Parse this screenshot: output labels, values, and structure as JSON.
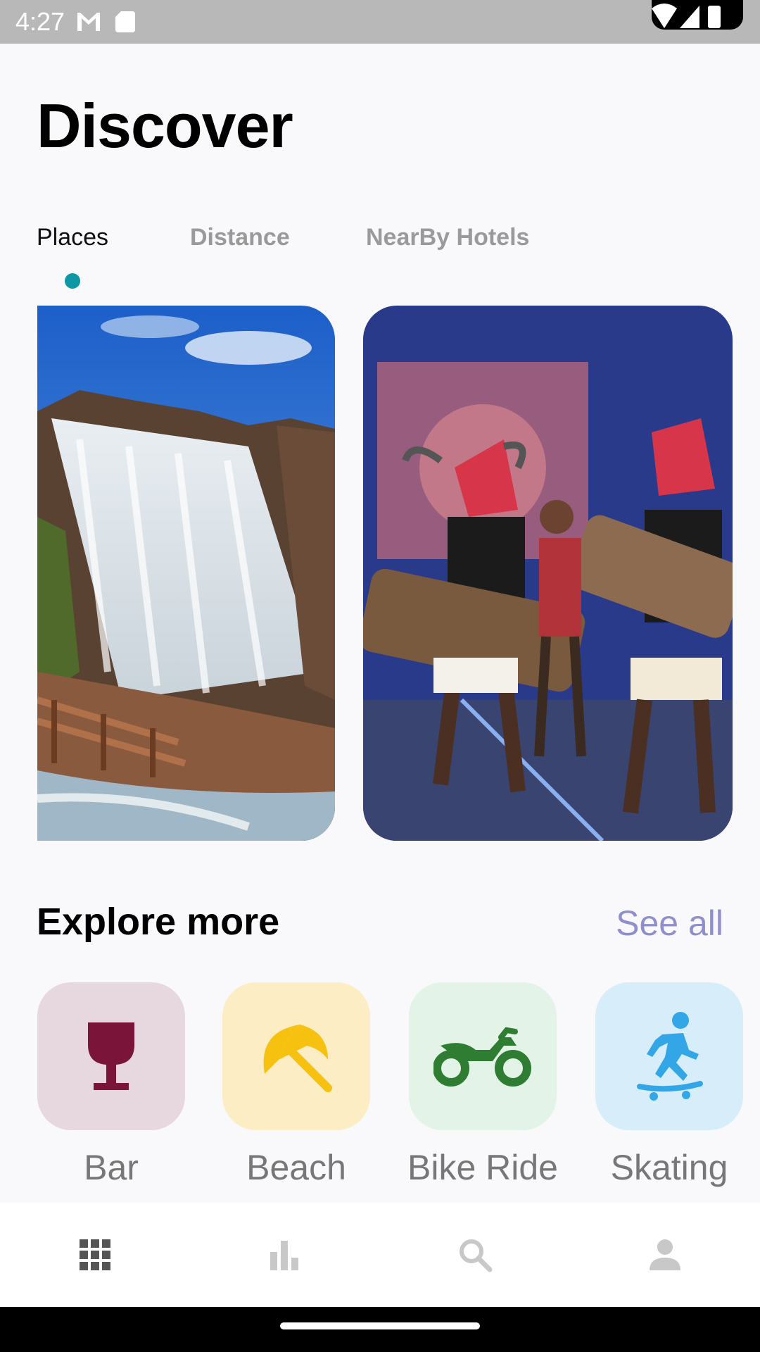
{
  "status_bar": {
    "time": "4:27"
  },
  "header": {
    "title": "Discover"
  },
  "tabs": [
    {
      "label": "Places"
    },
    {
      "label": "Distance"
    },
    {
      "label": "NearBy Hotels"
    }
  ],
  "explore": {
    "title": "Explore more",
    "see_all": "See all",
    "categories": [
      {
        "label": "Bar",
        "icon": "wine-glass-icon",
        "bg": "#e7d8df",
        "color": "#7a1439"
      },
      {
        "label": "Beach",
        "icon": "beach-umbrella-icon",
        "bg": "#fcedc5",
        "color": "#f7c20f"
      },
      {
        "label": "Bike Ride",
        "icon": "motorcycle-icon",
        "bg": "#e3f3e7",
        "color": "#2e7d32"
      },
      {
        "label": "Skating",
        "icon": "skateboarding-icon",
        "bg": "#d8edfa",
        "color": "#32a6e6"
      }
    ]
  },
  "colors": {
    "accent": "#0e97a5",
    "link": "#8f8fcf"
  }
}
